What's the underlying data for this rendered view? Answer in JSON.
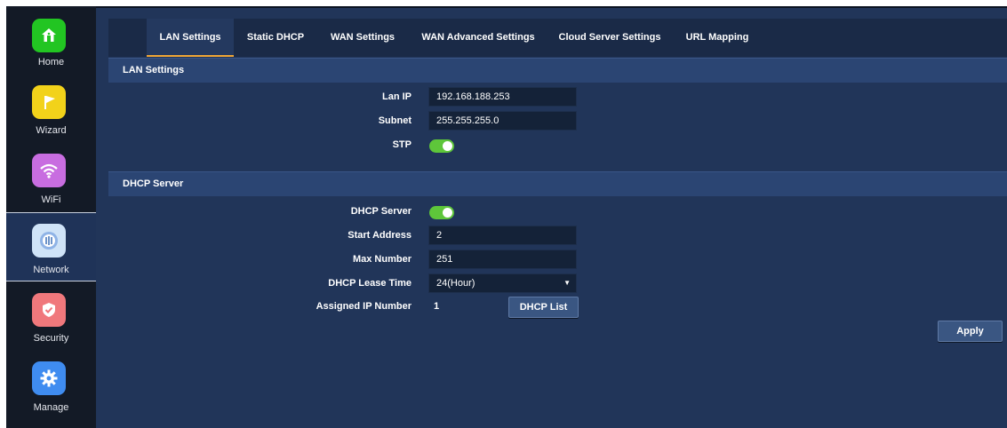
{
  "sidebar": {
    "items": [
      {
        "label": "Home",
        "icon": "home-icon",
        "color": "#22c522"
      },
      {
        "label": "Wizard",
        "icon": "wizard-flag-icon",
        "color": "#f2d21a"
      },
      {
        "label": "WiFi",
        "icon": "wifi-icon",
        "color": "#c86de0"
      },
      {
        "label": "Network",
        "icon": "network-icon",
        "color": "#cfe3f7",
        "active": true
      },
      {
        "label": "Security",
        "icon": "shield-icon",
        "color": "#f0787c"
      },
      {
        "label": "Manage",
        "icon": "gear-icon",
        "color": "#3f8cf0"
      }
    ]
  },
  "tabs": [
    {
      "label": "LAN Settings",
      "active": true
    },
    {
      "label": "Static DHCP"
    },
    {
      "label": "WAN Settings"
    },
    {
      "label": "WAN Advanced Settings"
    },
    {
      "label": "Cloud Server Settings"
    },
    {
      "label": "URL Mapping"
    }
  ],
  "lan": {
    "title": "LAN Settings",
    "lan_ip_label": "Lan IP",
    "lan_ip_value": "192.168.188.253",
    "subnet_label": "Subnet",
    "subnet_value": "255.255.255.0",
    "stp_label": "STP",
    "stp_on": true
  },
  "dhcp": {
    "title": "DHCP Server",
    "server_label": "DHCP Server",
    "server_on": true,
    "start_label": "Start Address",
    "start_value": "2",
    "max_label": "Max Number",
    "max_value": "251",
    "lease_label": "DHCP Lease Time",
    "lease_value": "24(Hour)",
    "assigned_label": "Assigned IP Number",
    "assigned_value": "1",
    "list_button": "DHCP List"
  },
  "apply_button": "Apply",
  "colors": {
    "accent": "#f0a635",
    "toggle_on": "#5ec63a",
    "background": "#213559"
  }
}
